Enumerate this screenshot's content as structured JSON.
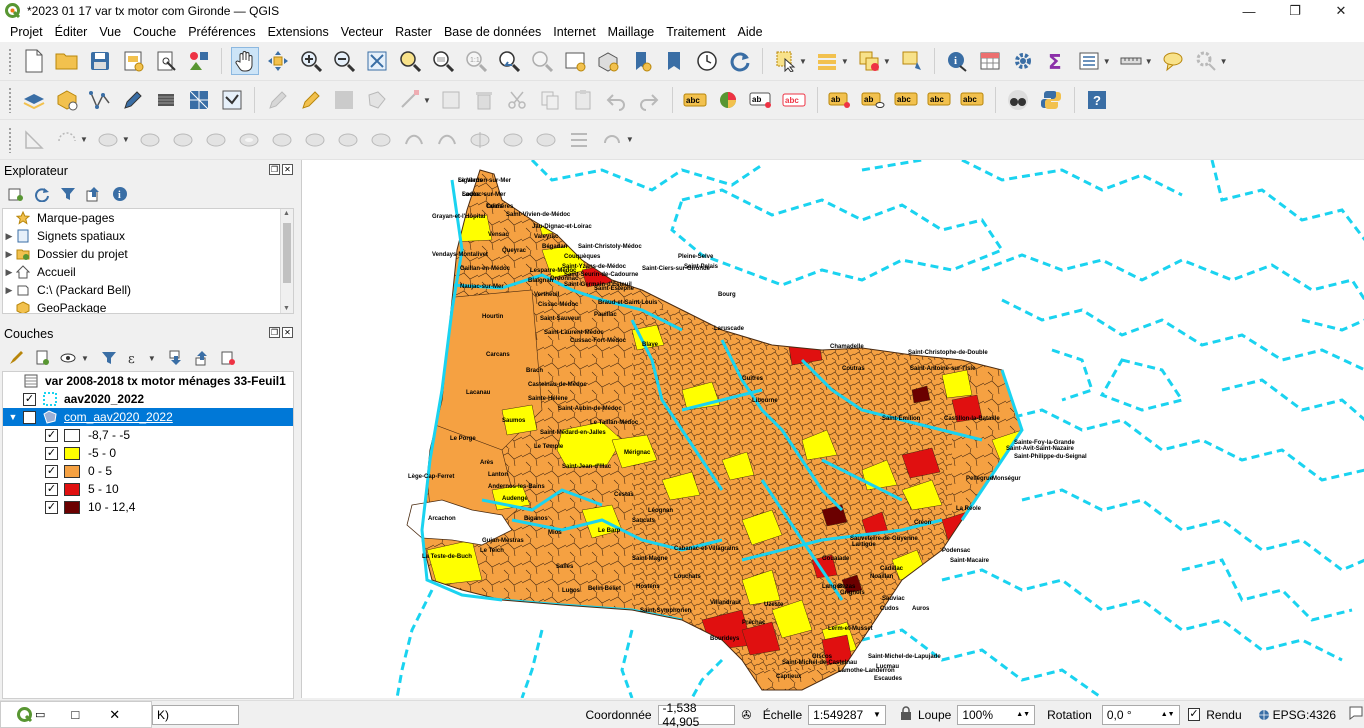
{
  "window": {
    "title": "*2023 01 17 var tx motor com Gironde — QGIS",
    "minimize": "—",
    "maximize": "❐",
    "close": "✕"
  },
  "menu": [
    {
      "label": "Projet"
    },
    {
      "label": "Éditer"
    },
    {
      "label": "Vue"
    },
    {
      "label": "Couche"
    },
    {
      "label": "Préférences"
    },
    {
      "label": "Extensions"
    },
    {
      "label": "Vecteur"
    },
    {
      "label": "Raster"
    },
    {
      "label": "Base de données"
    },
    {
      "label": "Internet"
    },
    {
      "label": "Maillage"
    },
    {
      "label": "Traitement"
    },
    {
      "label": "Aide"
    }
  ],
  "explorer": {
    "title": "Explorateur",
    "items": [
      {
        "label": "Marque-pages",
        "icon": "star-icon"
      },
      {
        "label": "Signets spatiaux",
        "icon": "bookmark-icon"
      },
      {
        "label": "Dossier du projet",
        "icon": "folder-icon"
      },
      {
        "label": "Accueil",
        "icon": "home-icon"
      },
      {
        "label": "C:\\ (Packard Bell)",
        "icon": "drive-icon"
      },
      {
        "label": "GeoPackage",
        "icon": "geopackage-icon"
      }
    ]
  },
  "layers": {
    "title": "Couches",
    "items": [
      {
        "label": "var 2008-2018 tx motor ménages 33-Feuil1"
      },
      {
        "label": "aav2020_2022"
      },
      {
        "label": "com_aav2020_2022"
      }
    ],
    "legend": [
      {
        "label": "-8,7 - -5",
        "color": "#ffffff"
      },
      {
        "label": "-5 - 0",
        "color": "#ffff00"
      },
      {
        "label": "0 - 5",
        "color": "#f5a142"
      },
      {
        "label": "5 - 10",
        "color": "#e01010"
      },
      {
        "label": "10 - 12,4",
        "color": "#6b0000"
      }
    ]
  },
  "map_labels": [
    "Le Verdon-sur-Mer",
    "Soulac-sur-Mer",
    "Talais",
    "Grayan-et-l'Hôpital",
    "Saint-Vivien-de-Médoc",
    "Jau-Dignac-et-Loirac",
    "Vensac",
    "Valeyrac",
    "Bégadan",
    "Saint-Christoly-Médoc",
    "Vendays-Montalivet",
    "Queyrac",
    "Couquèques",
    "Saint-Yzans-de-Médoc",
    "Saint-Seurin-de-Cadourne",
    "Gaillan-en-Médoc",
    "Lesparre-Médoc",
    "Naujac-sur-Mer",
    "Blaignan",
    "Ordonnac",
    "Saint-Germain-d'Esteuil",
    "Vertheuil",
    "Saint-Estèphe",
    "Hourtin",
    "Cissac-Médoc",
    "Pauillac",
    "Saint-Sauveur",
    "Saint-Laurent-Médoc",
    "Cussac-Fort-Médoc",
    "Carcans",
    "Lacanau",
    "Brach",
    "Castelnau-de-Médoc",
    "Sainte-Hélène",
    "Saint-Aubin-de-Médoc",
    "Saumos",
    "Le Porge",
    "Le Temple",
    "Saint-Médard-en-Jalles",
    "Le Taillan-Médoc",
    "Mérignac",
    "Saint-Jean-d'Illac",
    "Arès",
    "Lanton",
    "Andernos-les-Bains",
    "Audenge",
    "Lège-Cap-Ferret",
    "Arcachon",
    "La Teste-de-Buch",
    "Gujan-Mestras",
    "Le Teich",
    "Biganos",
    "Mios",
    "Salles",
    "Lugos",
    "Belin-Béliet",
    "Le Barp",
    "Saucats",
    "Cestas",
    "Léognan",
    "Cabanac-et-Villagrains",
    "Saint-Magne",
    "Hostens",
    "Louchats",
    "Saint-Symphorien",
    "Bourideys",
    "Captieux",
    "Lerm-et-Musset",
    "Grignols",
    "Bazas",
    "Langon",
    "Villandraut",
    "Préchac",
    "Uzeste",
    "Noaillan",
    "Blaye",
    "Bourg",
    "Saint-Ciers-sur-Gironde",
    "Pleine-Selve",
    "Saint-Palais",
    "Braud-et-Saint-Louis",
    "Laruscade",
    "Chamadelle",
    "Saint-Christophe-de-Double",
    "Saint-Antoine-sur-l'Isle",
    "Coutras",
    "Guîtres",
    "Libourne",
    "Saint-Émilion",
    "Castillon-la-Bataille",
    "Sainte-Foy-la-Grande",
    "Pellegrue",
    "Saint-Avit-Saint-Nazaire",
    "Saint-Philippe-du-Seignal",
    "Monségur",
    "La Réole",
    "Sauveterre-de-Guyenne",
    "Créon",
    "Cadillac",
    "Podensac",
    "Saint-Macaire",
    "Saint-Michel-de-Lapujade",
    "Lamothe-Landerron",
    "Saint-Michel-de-Castelnau",
    "Giscos",
    "Lucmau",
    "Escaudes",
    "Goualade",
    "Lartigue",
    "Sauviac",
    "Cudos",
    "Auros",
    "Sigalens",
    "Lados",
    "Coimères"
  ],
  "status": {
    "coord_label": "Coordonnée",
    "coord_value": "-1,538 44,905",
    "scale_label": "Échelle",
    "scale_value": "1:549287",
    "zoom_label": "Loupe",
    "zoom_value": "100%",
    "rotation_label": "Rotation",
    "rotation_value": "0,0 °",
    "render_label": "Rendu",
    "crs_label": "EPSG:4326",
    "locator_fragment": "K)"
  },
  "taskbar_popup": {
    "restore": "▭",
    "maximize": "□",
    "close": "✕"
  }
}
